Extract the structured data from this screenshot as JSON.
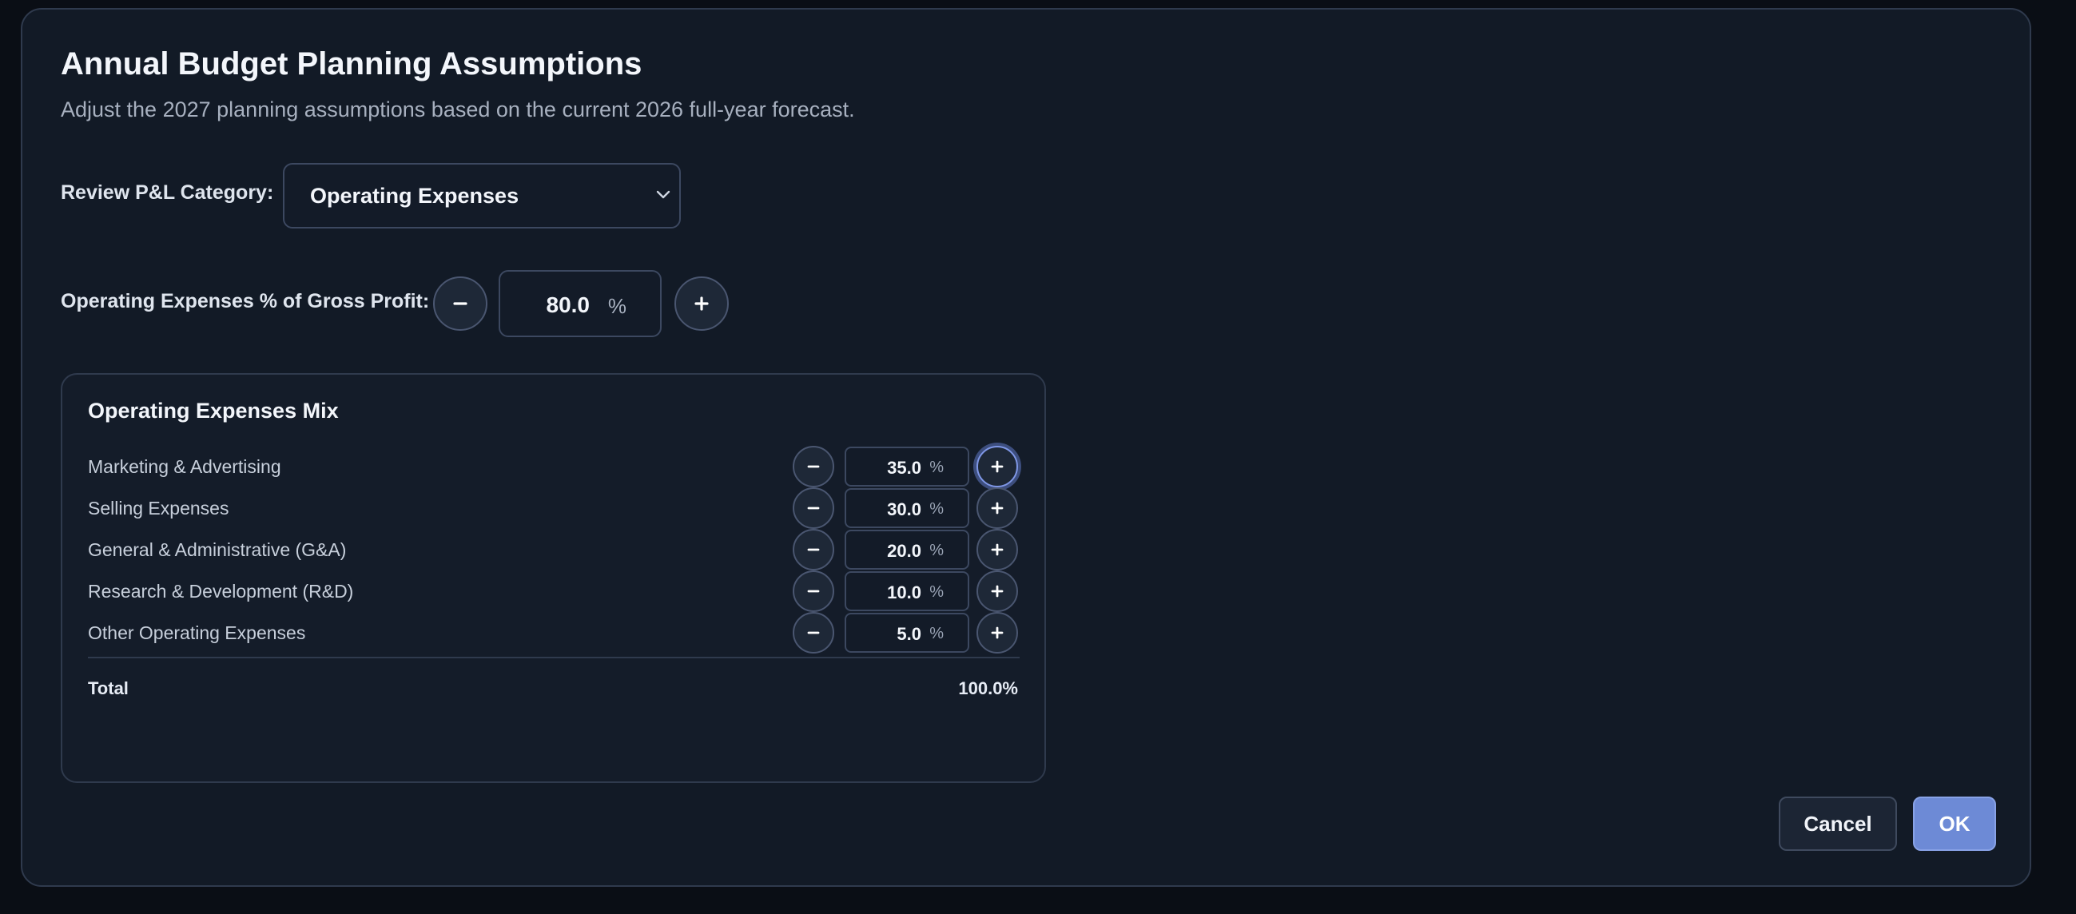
{
  "dialog": {
    "title": "Annual Budget Planning Assumptions",
    "subtitle": "Adjust the 2027 planning assumptions based on the current 2026 full-year forecast."
  },
  "category": {
    "label": "Review P&L Category:",
    "selected": "Operating Expenses"
  },
  "gross_profit_pct": {
    "label": "Operating Expenses % of Gross Profit:",
    "value": "80.0",
    "unit": "%"
  },
  "mix": {
    "title": "Operating Expenses Mix",
    "rows": [
      {
        "label": "Marketing & Advertising",
        "value": "35.0",
        "unit": "%"
      },
      {
        "label": "Selling Expenses",
        "value": "30.0",
        "unit": "%"
      },
      {
        "label": "General & Administrative (G&A)",
        "value": "20.0",
        "unit": "%"
      },
      {
        "label": "Research & Development (R&D)",
        "value": "10.0",
        "unit": "%"
      },
      {
        "label": "Other Operating Expenses",
        "value": "5.0",
        "unit": "%"
      }
    ],
    "total_label": "Total",
    "total_value": "100.0%"
  },
  "footer": {
    "cancel_label": "Cancel",
    "ok_label": "OK"
  },
  "icons": {
    "decrement": "minus-icon",
    "increment": "plus-icon",
    "dropdown": "chevron-down-icon"
  },
  "colors": {
    "background": "#0a0e15",
    "panel": "#121a26",
    "accent": "#6d8ad6",
    "focus_ring": "#7f97e6"
  }
}
